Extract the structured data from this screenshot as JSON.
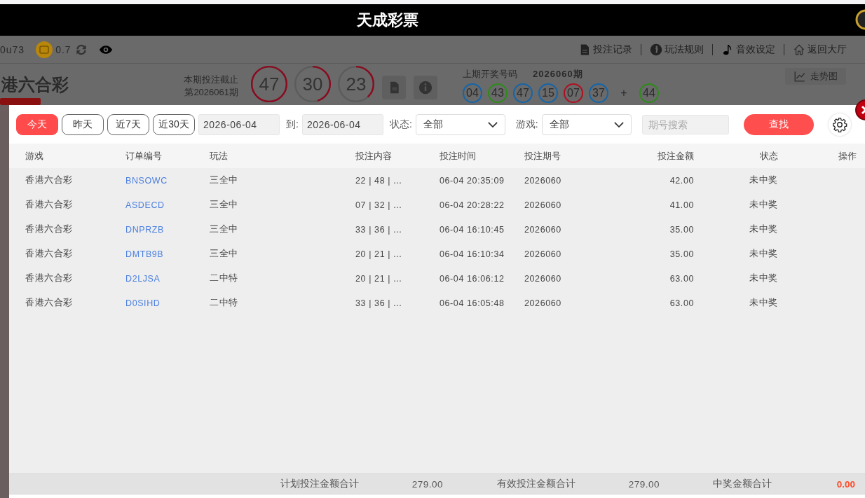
{
  "app_title": "天成彩票",
  "account": {
    "user": "0u73",
    "balance": "0.7"
  },
  "nav_links": [
    {
      "label": "投注记录",
      "kind": "document"
    },
    {
      "label": "玩法规则",
      "kind": "info"
    },
    {
      "label": "音效设定",
      "kind": "note"
    },
    {
      "label": "返回大厅",
      "kind": "home"
    }
  ],
  "game": {
    "name": "港六合彩",
    "deadline_label": "本期投注截止",
    "period": "第2026061期",
    "countdown": [
      {
        "value": "47",
        "level": 1
      },
      {
        "value": "30",
        "level": 0.45
      },
      {
        "value": "23",
        "level": 0.38
      }
    ],
    "last_draw_label": "上期开奖号码",
    "last_draw_period": "2026060期",
    "trend_button": "走势图",
    "balls": [
      {
        "number": "04",
        "color": "#1565a8"
      },
      {
        "number": "43",
        "color": "#2e8b1a"
      },
      {
        "number": "47",
        "color": "#1565a8"
      },
      {
        "number": "15",
        "color": "#1565a8"
      },
      {
        "number": "07",
        "color": "#b01020"
      },
      {
        "number": "37",
        "color": "#1565a8"
      }
    ],
    "separator": "+",
    "special_ball": {
      "number": "44",
      "color": "#2e8b1a"
    }
  },
  "filters": {
    "quick_ranges": [
      {
        "label": "今天",
        "selected": true
      },
      {
        "label": "昨天",
        "selected": false
      },
      {
        "label": "近7天",
        "selected": false
      },
      {
        "label": "近30天",
        "selected": false
      }
    ],
    "date_from": "2026-06-04",
    "to_label": "到:",
    "date_to": "2026-06-04",
    "status_label": "状态:",
    "status_value": "全部",
    "game_label": "游戏:",
    "game_value": "全部",
    "period_search": {
      "placeholder": "期号搜索"
    },
    "search_button": "查找"
  },
  "table": {
    "columns": [
      "游戏",
      "订单编号",
      "玩法",
      "投注内容",
      "投注时间",
      "投注期号",
      "投注金额",
      "状态",
      "操作"
    ],
    "rows": [
      [
        "香港六合彩",
        "BNSOWC",
        "三全中",
        "22 | 48 | ...",
        "06-04 20:35:09",
        "2026060",
        "42.00",
        "未中奖"
      ],
      [
        "香港六合彩",
        "ASDECD",
        "三全中",
        "07 | 32 | ...",
        "06-04 20:28:22",
        "2026060",
        "41.00",
        "未中奖"
      ],
      [
        "香港六合彩",
        "DNPRZB",
        "三全中",
        "33 | 36 | ...",
        "06-04 16:10:45",
        "2026060",
        "35.00",
        "未中奖"
      ],
      [
        "香港六合彩",
        "DMTB9B",
        "三全中",
        "20 | 21 | ...",
        "06-04 16:10:34",
        "2026060",
        "35.00",
        "未中奖"
      ],
      [
        "香港六合彩",
        "D2LJSA",
        "二中特",
        "20 | 21 | ...",
        "06-04 16:06:12",
        "2026060",
        "63.00",
        "未中奖"
      ],
      [
        "香港六合彩",
        "D0SIHD",
        "二中特",
        "33 | 36 | ...",
        "06-04 16:05:48",
        "2026060",
        "63.00",
        "未中奖"
      ]
    ]
  },
  "totals": {
    "planned_label": "计划投注金额合计",
    "planned": "279.00",
    "valid_label": "有效投注金额合计",
    "valid": "279.00",
    "win_label": "中奖金额合计",
    "win": "0.00"
  }
}
